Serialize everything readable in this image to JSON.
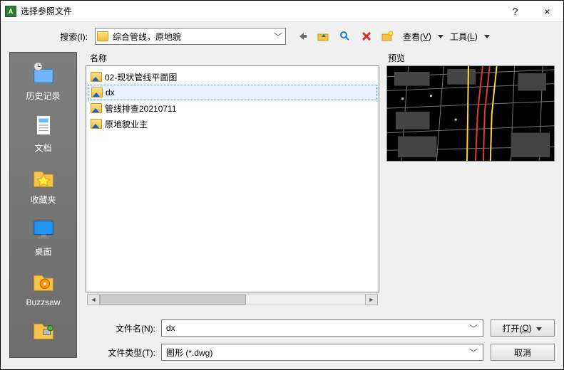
{
  "window": {
    "title": "选择参照文件",
    "help_symbol": "?",
    "close_symbol": "×"
  },
  "toolbar": {
    "search_label": "搜索(I):",
    "search_value": "综合管线，原地貌",
    "view_label_pre": "查看(",
    "view_accel": "V",
    "view_label_post": ")",
    "tools_label_pre": "工具(",
    "tools_accel": "L",
    "tools_label_post": ")"
  },
  "sidebar": {
    "items": [
      {
        "label": "历史记录"
      },
      {
        "label": "文档"
      },
      {
        "label": "收藏夹"
      },
      {
        "label": "桌面"
      },
      {
        "label": "Buzzsaw"
      },
      {
        "label": ""
      }
    ]
  },
  "file_list": {
    "header": "名称",
    "files": [
      {
        "name": "02-现状管线平面图",
        "selected": false
      },
      {
        "name": "dx",
        "selected": true
      },
      {
        "name": "管线排查20210711",
        "selected": false
      },
      {
        "name": "原地貌业主",
        "selected": false
      }
    ]
  },
  "preview": {
    "label": "预览"
  },
  "bottom": {
    "filename_label": "文件名(N):",
    "filename_value": "dx",
    "filetype_label": "文件类型(T):",
    "filetype_value": "图形 (*.dwg)",
    "open_label_pre": "打开(",
    "open_accel": "O",
    "open_label_post": ")",
    "cancel_label": "取消"
  }
}
